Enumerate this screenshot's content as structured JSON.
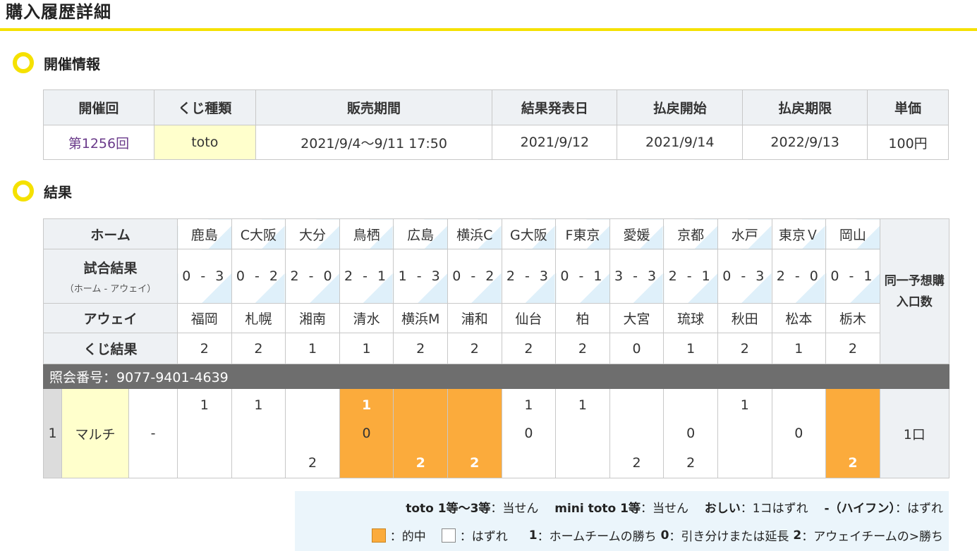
{
  "page": {
    "title": "購入履歴詳細"
  },
  "sections": {
    "info_title": "開催情報",
    "result_title": "結果"
  },
  "info": {
    "headers": [
      "開催回",
      "くじ種類",
      "販売期間",
      "結果発表日",
      "払戻開始",
      "払戻期限",
      "単価"
    ],
    "round": "第1256回",
    "kind": "toto",
    "sale_period": "2021/9/4～9/11 17:50",
    "result_date": "2021/9/12",
    "payout_start": "2021/9/14",
    "payout_deadline": "2022/9/13",
    "unit_price": "100円"
  },
  "result": {
    "home_label": "ホーム",
    "score_label": "試合結果",
    "score_sub": "（ホーム - アウェイ）",
    "away_label": "アウェイ",
    "lottery_label": "くじ結果",
    "count_label": "同一予想購入口数",
    "home": [
      "鹿島",
      "C大阪",
      "大分",
      "鳥栖",
      "広島",
      "横浜C",
      "G大阪",
      "F東京",
      "愛媛",
      "京都",
      "水戸",
      "東京Ｖ",
      "岡山"
    ],
    "scores": [
      "0 - 3",
      "0 - 2",
      "2 - 0",
      "2 - 1",
      "1 - 3",
      "0 - 2",
      "2 - 3",
      "0 - 1",
      "3 - 3",
      "2 - 1",
      "0 - 3",
      "2 - 0",
      "0 - 1"
    ],
    "away": [
      "福岡",
      "札幌",
      "湘南",
      "清水",
      "横浜M",
      "浦和",
      "仙台",
      "柏",
      "大宮",
      "琉球",
      "秋田",
      "松本",
      "栃木"
    ],
    "lottery": [
      "2",
      "2",
      "1",
      "1",
      "2",
      "2",
      "2",
      "2",
      "0",
      "1",
      "2",
      "1",
      "2"
    ],
    "reference": "照会番号：9077-9401-4639",
    "row": {
      "no": "1",
      "type": "マルチ",
      "dash": "-",
      "count": "1口",
      "picks": [
        {
          "p1": "1",
          "p0": "",
          "p2": "",
          "hit": false
        },
        {
          "p1": "1",
          "p0": "",
          "p2": "",
          "hit": false
        },
        {
          "p1": "",
          "p0": "",
          "p2": "2",
          "hit": false
        },
        {
          "p1": "1",
          "p0": "0",
          "p2": "",
          "hit": true,
          "sel": "p1"
        },
        {
          "p1": "",
          "p0": "",
          "p2": "2",
          "hit": true,
          "sel": "p2"
        },
        {
          "p1": "",
          "p0": "",
          "p2": "2",
          "hit": true,
          "sel": "p2"
        },
        {
          "p1": "1",
          "p0": "0",
          "p2": "",
          "hit": false
        },
        {
          "p1": "1",
          "p0": "",
          "p2": "",
          "hit": false
        },
        {
          "p1": "",
          "p0": "",
          "p2": "2",
          "hit": false
        },
        {
          "p1": "",
          "p0": "0",
          "p2": "2",
          "hit": false
        },
        {
          "p1": "1",
          "p0": "",
          "p2": "",
          "hit": false
        },
        {
          "p1": "",
          "p0": "0",
          "p2": "",
          "hit": false
        },
        {
          "p1": "",
          "p0": "",
          "p2": "2",
          "hit": true,
          "sel": "p2"
        }
      ]
    }
  },
  "legend": {
    "toto_label": "toto 1等～3等",
    "toto_value": "：当せん",
    "mini_label": "mini toto 1等",
    "mini_value": "：当せん",
    "oshii_label": "おしい",
    "oshii_value": "：1コはずれ",
    "hyphen_label": "-（ハイフン）",
    "hyphen_value": "：はずれ",
    "hit_text": "：的中",
    "miss_text": "：はずれ",
    "k1": "1",
    "v1": "：ホームチームの勝ち",
    "k0": "0",
    "v0": "：引き分けまたは延長",
    "k2": "2",
    "v2": "：アウェイチームの>勝ち"
  },
  "colors": {
    "accent": "#f5e100",
    "hit": "#fbab3c",
    "header_bg": "#eef1f4",
    "kind_bg": "#ffffcc"
  }
}
